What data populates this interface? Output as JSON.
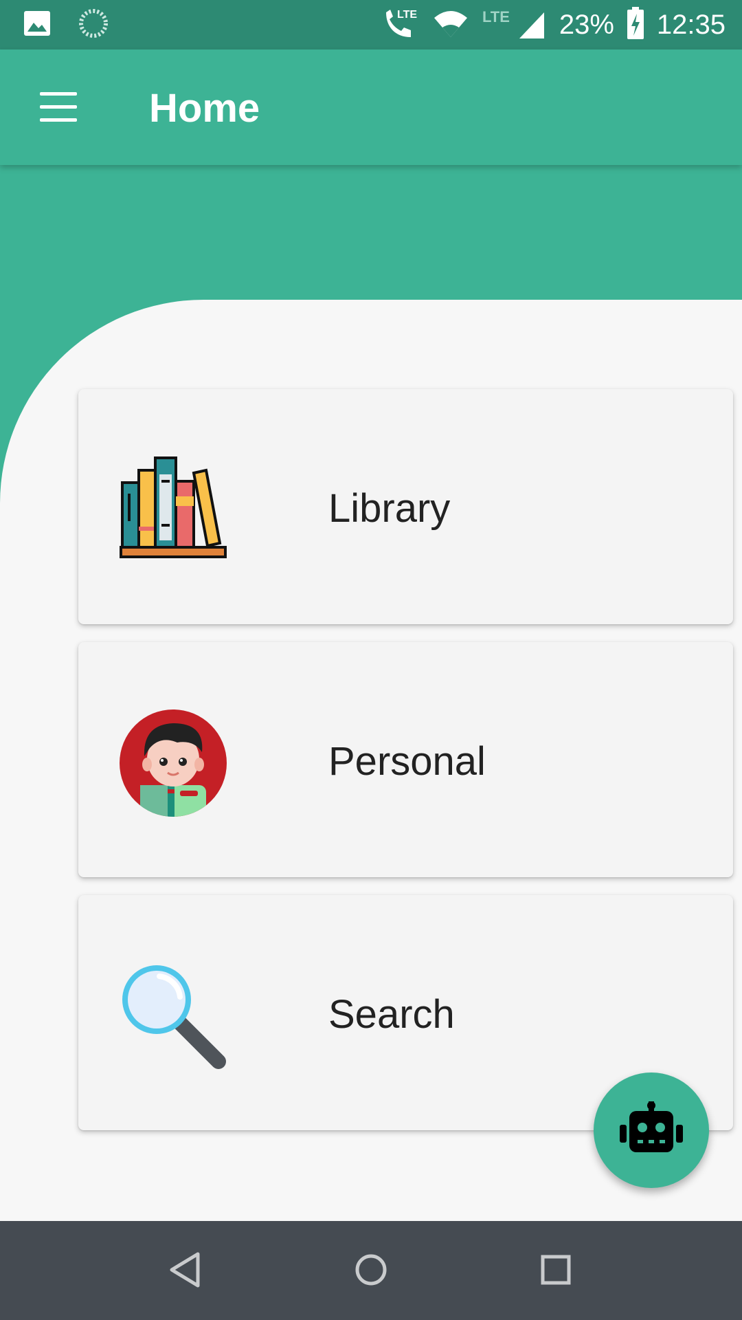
{
  "status_bar": {
    "battery": "23%",
    "time": "12:35",
    "icons": [
      "image-icon",
      "sync-icon",
      "lte-call-icon",
      "wifi-icon",
      "lte-signal-icon",
      "battery-charging-icon"
    ]
  },
  "app_bar": {
    "title": "Home",
    "menu_icon": "hamburger-menu-icon"
  },
  "cards": [
    {
      "label": "Library",
      "icon": "books-icon"
    },
    {
      "label": "Personal",
      "icon": "person-avatar-icon"
    },
    {
      "label": "Search",
      "icon": "magnifier-icon"
    }
  ],
  "fab": {
    "icon": "robot-icon"
  },
  "nav_bar": {
    "icons": [
      "back-icon",
      "home-icon",
      "recents-icon"
    ]
  },
  "colors": {
    "primary": "#3db395",
    "primary_dark": "#2d8a73",
    "background": "#f7f7f7",
    "nav_bar": "#454b52"
  }
}
